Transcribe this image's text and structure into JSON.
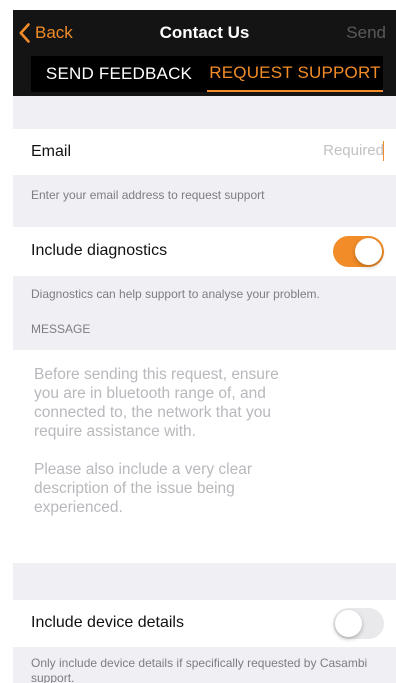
{
  "nav": {
    "back_label": "Back",
    "title": "Contact Us",
    "send_label": "Send"
  },
  "tabs": [
    {
      "label": "SEND FEEDBACK",
      "active": false
    },
    {
      "label": "REQUEST SUPPORT",
      "active": true
    }
  ],
  "email": {
    "label": "Email",
    "placeholder": "Required",
    "value": "",
    "caption": "Enter your email address to request support"
  },
  "diagnostics": {
    "label": "Include diagnostics",
    "enabled": true,
    "caption": "Diagnostics can help support to analyse your problem."
  },
  "message": {
    "section_header": "MESSAGE",
    "placeholder": "Before sending this request, ensure\nyou are in bluetooth range of, and\nconnected to, the network that you\nrequire assistance with.\n\nPlease also include a very clear\ndescription of the issue being\nexperienced."
  },
  "device_details": {
    "label": "Include device details",
    "enabled": false,
    "caption": "Only include device details if specifically requested by Casambi support."
  },
  "colors": {
    "accent": "#f28c28",
    "nav_background": "#141414",
    "grouped_background": "#efeff4"
  },
  "icons": {
    "back": "chevron-left-icon"
  }
}
